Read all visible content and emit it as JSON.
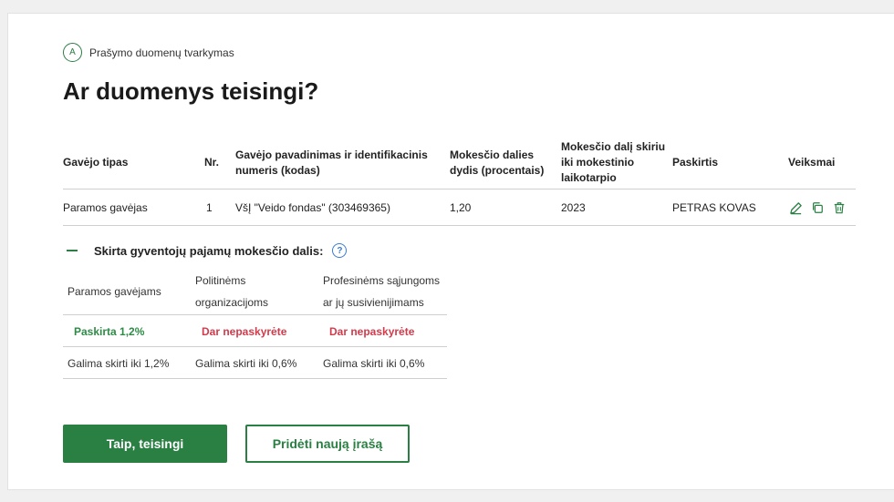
{
  "step": {
    "letter": "A",
    "label": "Prašymo duomenų tvarkymas"
  },
  "title": "Ar duomenys teisingi?",
  "table": {
    "headers": {
      "type": "Gavėjo tipas",
      "nr": "Nr.",
      "name": "Gavėjo pavadinimas ir identifikacinis numeris (kodas)",
      "share": "Mokesčio dalies dydis (procentais)",
      "period": "Mokesčio dalį skiriu iki mokestinio laikotarpio",
      "assignee": "Paskirtis",
      "actions": "Veiksmai"
    },
    "rows": [
      {
        "type": "Paramos gavėjas",
        "nr": "1",
        "name": "VšĮ \"Veido fondas\" (303469365)",
        "share": "1,20",
        "period": "2023",
        "assignee": "PETRAS KOVAS"
      }
    ],
    "action_icons": [
      "edit-icon",
      "copy-icon",
      "delete-icon"
    ]
  },
  "allocation": {
    "heading": "Skirta gyventojų pajamų mokesčio dalis:",
    "help_glyph": "?",
    "columns": [
      {
        "header": "Paramos gavėjams",
        "status": "Paskirta 1,2%",
        "limit": "Galima skirti iki 1,2%"
      },
      {
        "header": "Politinėms organizacijoms",
        "status": "Dar nepaskyrėte",
        "limit": "Galima skirti iki 0,6%"
      },
      {
        "header": "Profesinėms sąjungoms ar jų susivienijimams",
        "status": "Dar nepaskyrėte",
        "limit": "Galima skirti iki 0,6%"
      }
    ]
  },
  "buttons": {
    "confirm": "Taip, teisingi",
    "add": "Pridėti naują įrašą"
  },
  "colors": {
    "accent": "#2a7f43",
    "status_ok": "#2e8b46",
    "status_none": "#d13b4b",
    "help": "#3a7bd5"
  }
}
